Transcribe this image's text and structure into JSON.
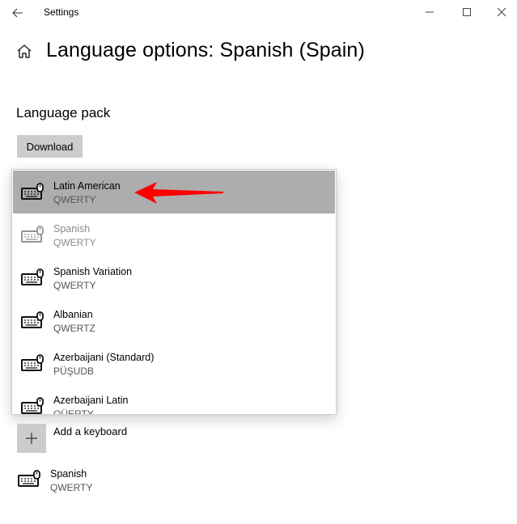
{
  "window": {
    "title": "Settings",
    "controls": [
      "minimize",
      "maximize",
      "close"
    ]
  },
  "page": {
    "title": "Language options: Spanish (Spain)"
  },
  "language_pack": {
    "heading": "Language pack",
    "download_label": "Download"
  },
  "keyboard_dropdown": {
    "items": [
      {
        "name": "Latin American",
        "layout": "QWERTY",
        "state": "highlighted",
        "icon": "keyboard-icon"
      },
      {
        "name": "Spanish",
        "layout": "QWERTY",
        "state": "disabled",
        "icon": "keyboard-icon"
      },
      {
        "name": "Spanish Variation",
        "layout": "QWERTY",
        "state": "normal",
        "icon": "keyboard-icon"
      },
      {
        "name": "Albanian",
        "layout": "QWERTZ",
        "state": "normal",
        "icon": "keyboard-icon"
      },
      {
        "name": "Azerbaijani (Standard)",
        "layout": "PÜŞUDB",
        "state": "normal",
        "icon": "keyboard-icon"
      },
      {
        "name": "Azerbaijani Latin",
        "layout": "QÜERTY",
        "state": "normal",
        "icon": "keyboard-icon"
      }
    ]
  },
  "keyboards": {
    "add_label": "Add a keyboard",
    "installed": [
      {
        "name": "Spanish",
        "layout": "QWERTY"
      }
    ]
  },
  "annotation": {
    "arrow_color": "#ff0000"
  }
}
